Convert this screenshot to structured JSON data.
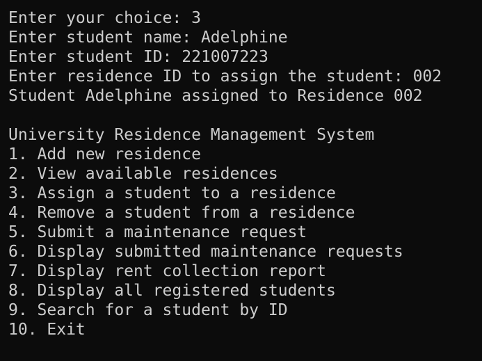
{
  "terminal": {
    "fg_color": "#cccccc",
    "bg_color": "#0c0c0c",
    "session": [
      "Enter your choice: 3",
      "Enter student name: Adelphine",
      "Enter student ID: 221007223",
      "Enter residence ID to assign the student: 002",
      "Student Adelphine assigned to Residence 002"
    ],
    "menu": {
      "title": "University Residence Management System",
      "items": [
        "1. Add new residence",
        "2. View available residences",
        "3. Assign a student to a residence",
        "4. Remove a student from a residence",
        "5. Submit a maintenance request",
        "6. Display submitted maintenance requests",
        "7. Display rent collection report",
        "8. Display all registered students",
        "9. Search for a student by ID",
        "10. Exit"
      ]
    }
  }
}
